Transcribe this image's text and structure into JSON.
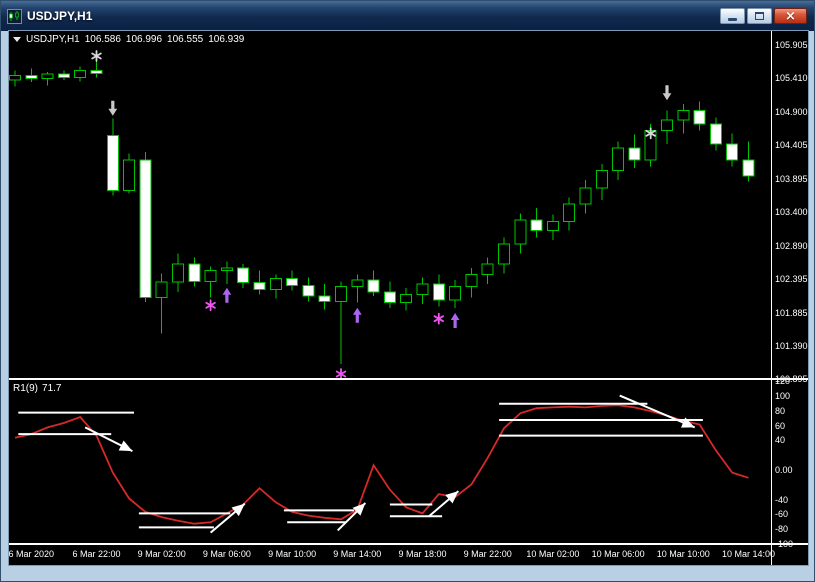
{
  "window": {
    "title": "USDJPY,H1",
    "close_glyph": "×"
  },
  "main_chart": {
    "symbol": "USDJPY,H1",
    "open": "106.586",
    "high": "106.996",
    "low": "106.555",
    "close": "106.939"
  },
  "indicator_panel": {
    "name": "R1(9)",
    "value": "71.7"
  },
  "colors": {
    "background": "#000000",
    "window_frame": "#b9cfe4",
    "candle_outline": "#00c400",
    "bull_body": "#000000",
    "bear_body": "#ffffff",
    "indicator_line": "#d62929",
    "level_line": "#ffffff",
    "axis_text": "#ffffff",
    "signal_star_magenta": "#ee55ee",
    "signal_arrow_violet": "#aa66ee",
    "signal_white": "#d9d9d9"
  },
  "chart_data": {
    "type": "candlestick",
    "symbol": "USDJPY",
    "timeframe": "H1",
    "main": {
      "type": "candlestick",
      "y_labels": [
        "105.905",
        "105.410",
        "104.900",
        "104.405",
        "103.895",
        "103.400",
        "102.890",
        "102.395",
        "101.885",
        "101.390",
        "100.895"
      ],
      "bars_ohlc": [
        [
          105.38,
          105.52,
          105.28,
          105.45
        ],
        [
          105.45,
          105.55,
          105.35,
          105.4
        ],
        [
          105.4,
          105.5,
          105.3,
          105.47
        ],
        [
          105.47,
          105.52,
          105.38,
          105.42
        ],
        [
          105.42,
          105.58,
          105.36,
          105.52
        ],
        [
          105.52,
          105.66,
          105.42,
          105.48
        ],
        [
          104.55,
          104.8,
          103.65,
          103.72
        ],
        [
          103.72,
          104.28,
          103.68,
          104.18
        ],
        [
          104.18,
          104.3,
          102.05,
          102.12
        ],
        [
          102.12,
          102.48,
          101.58,
          102.35
        ],
        [
          102.35,
          102.78,
          102.2,
          102.62
        ],
        [
          102.62,
          102.72,
          102.28,
          102.36
        ],
        [
          102.36,
          102.58,
          102.12,
          102.52
        ],
        [
          102.52,
          102.66,
          102.32,
          102.56
        ],
        [
          102.56,
          102.62,
          102.26,
          102.34
        ],
        [
          102.34,
          102.52,
          102.16,
          102.24
        ],
        [
          102.24,
          102.46,
          102.1,
          102.4
        ],
        [
          102.4,
          102.52,
          102.22,
          102.3
        ],
        [
          102.3,
          102.42,
          102.06,
          102.14
        ],
        [
          102.14,
          102.32,
          101.94,
          102.06
        ],
        [
          102.06,
          102.36,
          101.12,
          102.28
        ],
        [
          102.28,
          102.46,
          102.04,
          102.38
        ],
        [
          102.38,
          102.52,
          102.14,
          102.2
        ],
        [
          102.2,
          102.36,
          101.96,
          102.04
        ],
        [
          102.04,
          102.26,
          101.92,
          102.16
        ],
        [
          102.16,
          102.42,
          102.02,
          102.32
        ],
        [
          102.32,
          102.46,
          101.98,
          102.08
        ],
        [
          102.08,
          102.38,
          101.96,
          102.28
        ],
        [
          102.28,
          102.56,
          102.12,
          102.46
        ],
        [
          102.46,
          102.72,
          102.32,
          102.62
        ],
        [
          102.62,
          103.02,
          102.48,
          102.92
        ],
        [
          102.92,
          103.38,
          102.78,
          103.28
        ],
        [
          103.28,
          103.46,
          103.02,
          103.12
        ],
        [
          103.12,
          103.36,
          102.98,
          103.26
        ],
        [
          103.26,
          103.62,
          103.12,
          103.52
        ],
        [
          103.52,
          103.88,
          103.38,
          103.76
        ],
        [
          103.76,
          104.12,
          103.58,
          104.02
        ],
        [
          104.02,
          104.46,
          103.88,
          104.36
        ],
        [
          104.36,
          104.56,
          104.06,
          104.18
        ],
        [
          104.18,
          104.72,
          104.08,
          104.62
        ],
        [
          104.62,
          104.92,
          104.42,
          104.78
        ],
        [
          104.78,
          105.02,
          104.58,
          104.92
        ],
        [
          104.92,
          105.06,
          104.62,
          104.72
        ],
        [
          104.72,
          104.82,
          104.32,
          104.42
        ],
        [
          104.42,
          104.58,
          104.08,
          104.18
        ],
        [
          104.18,
          104.46,
          103.86,
          103.94
        ]
      ],
      "markers": [
        {
          "bar": 5,
          "price": 105.74,
          "shape": "star",
          "color": "#d9d9d9"
        },
        {
          "bar": 6,
          "price": 104.95,
          "shape": "arrow-down",
          "color": "#c9c9c9"
        },
        {
          "bar": 12,
          "price": 102.0,
          "shape": "star",
          "color": "#ee55ee"
        },
        {
          "bar": 13,
          "price": 102.16,
          "shape": "arrow-up",
          "color": "#aa66ee"
        },
        {
          "bar": 20,
          "price": 100.97,
          "shape": "star",
          "color": "#ee55ee"
        },
        {
          "bar": 21,
          "price": 101.86,
          "shape": "arrow-up",
          "color": "#aa66ee"
        },
        {
          "bar": 26,
          "price": 101.8,
          "shape": "star",
          "color": "#ee55ee"
        },
        {
          "bar": 27,
          "price": 101.78,
          "shape": "arrow-up",
          "color": "#aa66ee"
        },
        {
          "bar": 39,
          "price": 104.58,
          "shape": "star",
          "color": "#d9d9d9"
        },
        {
          "bar": 40,
          "price": 105.18,
          "shape": "arrow-down",
          "color": "#c9c9c9"
        }
      ]
    },
    "indicator": {
      "type": "line",
      "name": "R1(9)",
      "current_value": 71.7,
      "y_labels": [
        "120",
        "100",
        "80",
        "60",
        "40",
        "0.00",
        "-40",
        "-60",
        "-80",
        "-100"
      ],
      "values": [
        42,
        47,
        56,
        62,
        70,
        45,
        -5,
        -40,
        -58,
        -65,
        -70,
        -74,
        -72,
        -60,
        -48,
        -26,
        -45,
        -58,
        -63,
        -66,
        -68,
        -55,
        5,
        -28,
        -52,
        -60,
        -34,
        -38,
        -21,
        15,
        55,
        75,
        82,
        83,
        84,
        83,
        85,
        86,
        83,
        78,
        72,
        65,
        60,
        25,
        -5,
        -12
      ],
      "level_segments": [
        {
          "from": [
            0.2,
            76
          ],
          "to": [
            7.3,
            76
          ],
          "arrow": false
        },
        {
          "from": [
            0.2,
            47
          ],
          "to": [
            5.9,
            47
          ],
          "arrow": false
        },
        {
          "from": [
            4.3,
            56
          ],
          "to": [
            7.2,
            24
          ],
          "arrow": true
        },
        {
          "from": [
            7.6,
            -60
          ],
          "to": [
            13.2,
            -60
          ],
          "arrow": false
        },
        {
          "from": [
            7.6,
            -79
          ],
          "to": [
            12.2,
            -79
          ],
          "arrow": false
        },
        {
          "from": [
            12.0,
            -86
          ],
          "to": [
            14.1,
            -47
          ],
          "arrow": true
        },
        {
          "from": [
            16.5,
            -56
          ],
          "to": [
            20.8,
            -56
          ],
          "arrow": false
        },
        {
          "from": [
            16.7,
            -72
          ],
          "to": [
            20.3,
            -72
          ],
          "arrow": false
        },
        {
          "from": [
            19.8,
            -83
          ],
          "to": [
            21.5,
            -46
          ],
          "arrow": true
        },
        {
          "from": [
            23.0,
            -48
          ],
          "to": [
            25.6,
            -48
          ],
          "arrow": false
        },
        {
          "from": [
            23.0,
            -64
          ],
          "to": [
            26.2,
            -64
          ],
          "arrow": false
        },
        {
          "from": [
            25.4,
            -64
          ],
          "to": [
            27.2,
            -30
          ],
          "arrow": true
        },
        {
          "from": [
            29.7,
            88
          ],
          "to": [
            38.8,
            88
          ],
          "arrow": false
        },
        {
          "from": [
            29.7,
            66
          ],
          "to": [
            42.2,
            66
          ],
          "arrow": false
        },
        {
          "from": [
            29.7,
            45
          ],
          "to": [
            42.2,
            45
          ],
          "arrow": false
        },
        {
          "from": [
            37.1,
            99
          ],
          "to": [
            41.7,
            56
          ],
          "arrow": true
        }
      ]
    },
    "x_axis": {
      "labels": [
        "6 Mar 2020",
        "6 Mar 22:00",
        "9 Mar 02:00",
        "9 Mar 06:00",
        "9 Mar 10:00",
        "9 Mar 14:00",
        "9 Mar 18:00",
        "9 Mar 22:00",
        "10 Mar 02:00",
        "10 Mar 06:00",
        "10 Mar 10:00",
        "10 Mar 14:00"
      ],
      "first_label_bar": 1,
      "label_every_bars": 4
    }
  }
}
